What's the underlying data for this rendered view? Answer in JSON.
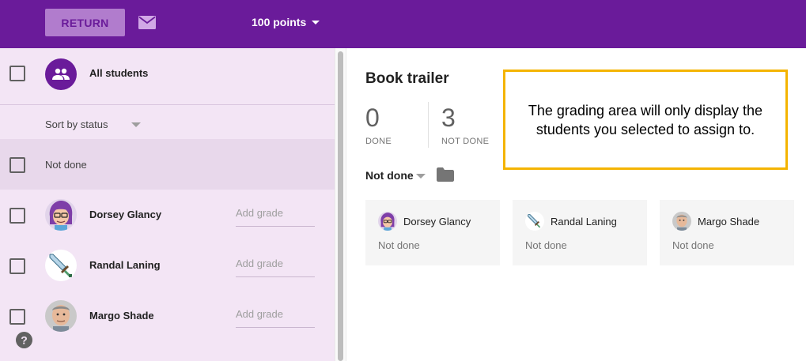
{
  "topbar": {
    "return_label": "RETURN",
    "points_label": "100 points"
  },
  "left_panel": {
    "all_students_label": "All students",
    "sort_label": "Sort by status",
    "group_label": "Not done",
    "students": [
      {
        "name": "Dorsey Glancy",
        "grade_placeholder": "Add grade"
      },
      {
        "name": "Randal Laning",
        "grade_placeholder": "Add grade"
      },
      {
        "name": "Margo Shade",
        "grade_placeholder": "Add grade"
      }
    ]
  },
  "assignment": {
    "title": "Book trailer",
    "done_count": "0",
    "done_label": "DONE",
    "not_done_count": "3",
    "not_done_label": "NOT DONE",
    "filter_label": "Not done"
  },
  "callout": {
    "text": "The grading area will only display the students you selected to assign to."
  },
  "cards": [
    {
      "name": "Dorsey Glancy",
      "status": "Not done"
    },
    {
      "name": "Randal Laning",
      "status": "Not done"
    },
    {
      "name": "Margo Shade",
      "status": "Not done"
    }
  ],
  "colors": {
    "brand_purple": "#6a1b9a",
    "panel_lavender": "#f3e5f5",
    "callout_border": "#f4b400"
  }
}
